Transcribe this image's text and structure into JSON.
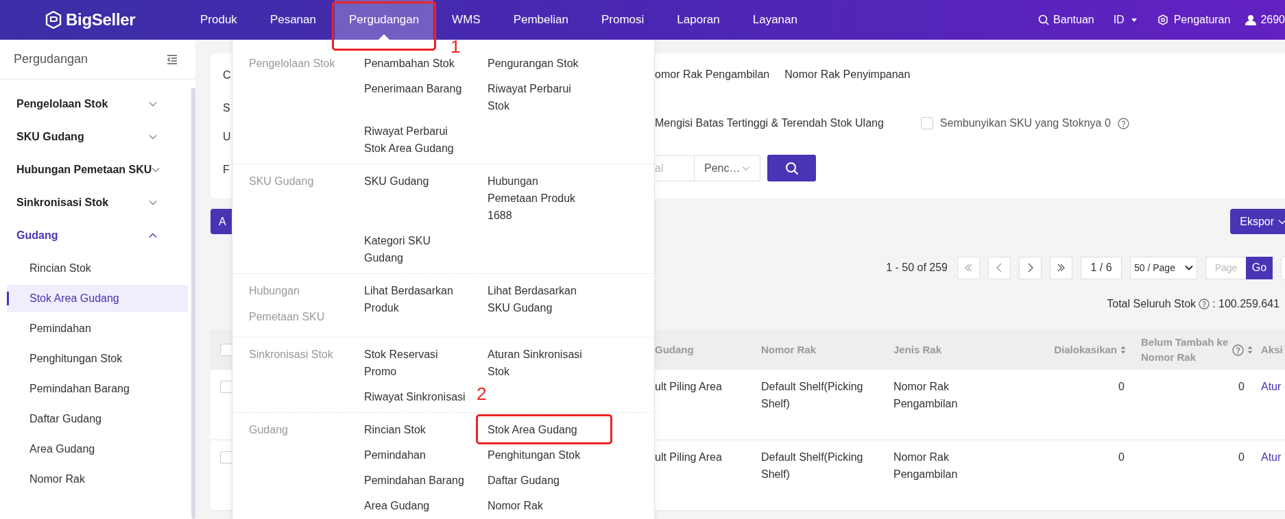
{
  "topbar": {
    "logo": "BigSeller",
    "nav": [
      {
        "label": "Produk",
        "selected": false
      },
      {
        "label": "Pesanan",
        "selected": false
      },
      {
        "label": "Pergudangan",
        "selected": true,
        "annotation": "1"
      },
      {
        "label": "WMS",
        "selected": false
      },
      {
        "label": "Pembelian",
        "selected": false
      },
      {
        "label": "Promosi",
        "selected": false
      },
      {
        "label": "Laporan",
        "selected": false
      },
      {
        "label": "Layanan",
        "selected": false
      }
    ],
    "help": "Bantuan",
    "language": "ID",
    "settings": "Pengaturan",
    "user": "2690"
  },
  "sidebar": {
    "title": "Pergudangan",
    "groups": [
      {
        "label": "Pengelolaan Stok",
        "expanded": false
      },
      {
        "label": "SKU Gudang",
        "expanded": false
      },
      {
        "label": "Hubungan Pemetaan SKU",
        "expanded": false
      },
      {
        "label": "Sinkronisasi Stok",
        "expanded": false
      },
      {
        "label": "Gudang",
        "expanded": true,
        "children": [
          {
            "label": "Rincian Stok",
            "selected": false
          },
          {
            "label": "Stok Area Gudang",
            "selected": true
          },
          {
            "label": "Pemindahan",
            "selected": false
          },
          {
            "label": "Penghitungan Stok",
            "selected": false
          },
          {
            "label": "Pemindahan Barang",
            "selected": false
          },
          {
            "label": "Daftar Gudang",
            "selected": false
          },
          {
            "label": "Area Gudang",
            "selected": false
          },
          {
            "label": "Nomor Rak",
            "selected": false
          }
        ]
      }
    ]
  },
  "filter_card": {
    "row_labels": [
      "C",
      "S",
      "U",
      "F"
    ],
    "shelf_types": [
      "omor Rak Pengambilan",
      "Nomor Rak Penyimpanan"
    ],
    "options": [
      {
        "kind": "text",
        "label": "Mengisi Batas Tertinggi & Terendah Stok Ulang"
      },
      {
        "kind": "checkbox",
        "label": "Sembunyikan SKU yang Stoknya 0",
        "checked": false,
        "help": true
      }
    ],
    "search": {
      "placeholder": "al",
      "select": "Penc…"
    }
  },
  "toolbar": {
    "action_button": "A",
    "export_button": "Ekspor"
  },
  "pagination": {
    "range": "1 - 50 of 259",
    "page": "1 / 6",
    "page_size": "50 / Page",
    "jump_placeholder": "Page",
    "go": "Go"
  },
  "total": {
    "label": "Total Seluruh Stok",
    "value": ": 100.259.641"
  },
  "table": {
    "all_checked": false,
    "columns": [
      {
        "label": "Gudang",
        "kind": "text"
      },
      {
        "label": "Nomor Rak",
        "kind": "text"
      },
      {
        "label": "Jenis Rak",
        "kind": "text"
      },
      {
        "label": "Dialokasikan",
        "kind": "number",
        "sortable": true
      },
      {
        "label": "Belum Tambah ke Nomor Rak",
        "kind": "number",
        "sortable": true,
        "help": true
      },
      {
        "label": "Aksi",
        "kind": "action"
      }
    ],
    "rows": [
      {
        "checked": false,
        "cells": [
          "ult Piling Area",
          "Default Shelf(Picking Shelf)",
          "Nomor Rak Pengambilan",
          "0",
          "0",
          "Atur"
        ]
      },
      {
        "checked": false,
        "cells": [
          "ult Piling Area",
          "Default Shelf(Picking Shelf)",
          "Nomor Rak Pengambilan",
          "0",
          "0",
          "Atur"
        ]
      }
    ]
  },
  "menu": {
    "sections": [
      {
        "label": "Pengelolaan Stok",
        "items": [
          {
            "label": "Penambahan Stok"
          },
          {
            "label": "Pengurangan Stok"
          },
          {
            "label": "Penerimaan Barang"
          },
          {
            "label": "Riwayat Perbarui Stok"
          },
          {
            "label": "Riwayat Perbarui Stok Area Gudang"
          }
        ]
      },
      {
        "label": "SKU Gudang",
        "items": [
          {
            "label": "SKU Gudang"
          },
          {
            "label": "Hubungan Pemetaan Produk 1688"
          },
          {
            "label": "Kategori SKU Gudang"
          }
        ]
      },
      {
        "label": "Hubungan Pemetaan SKU",
        "items": [
          {
            "label": "Lihat Berdasarkan Produk"
          },
          {
            "label": "Lihat Berdasarkan SKU Gudang"
          }
        ]
      },
      {
        "label": "Sinkronisasi Stok",
        "items": [
          {
            "label": "Stok Reservasi Promo"
          },
          {
            "label": "Aturan Sinkronisasi Stok"
          },
          {
            "label": "Riwayat Sinkronisasi"
          }
        ]
      },
      {
        "label": "Gudang",
        "items": [
          {
            "label": "Rincian Stok"
          },
          {
            "label": "Stok Area Gudang",
            "annotation": "2"
          },
          {
            "label": "Pemindahan"
          },
          {
            "label": "Penghitungan Stok"
          },
          {
            "label": "Pemindahan Barang"
          },
          {
            "label": "Daftar Gudang"
          },
          {
            "label": "Area Gudang"
          },
          {
            "label": "Nomor Rak"
          }
        ]
      }
    ]
  }
}
